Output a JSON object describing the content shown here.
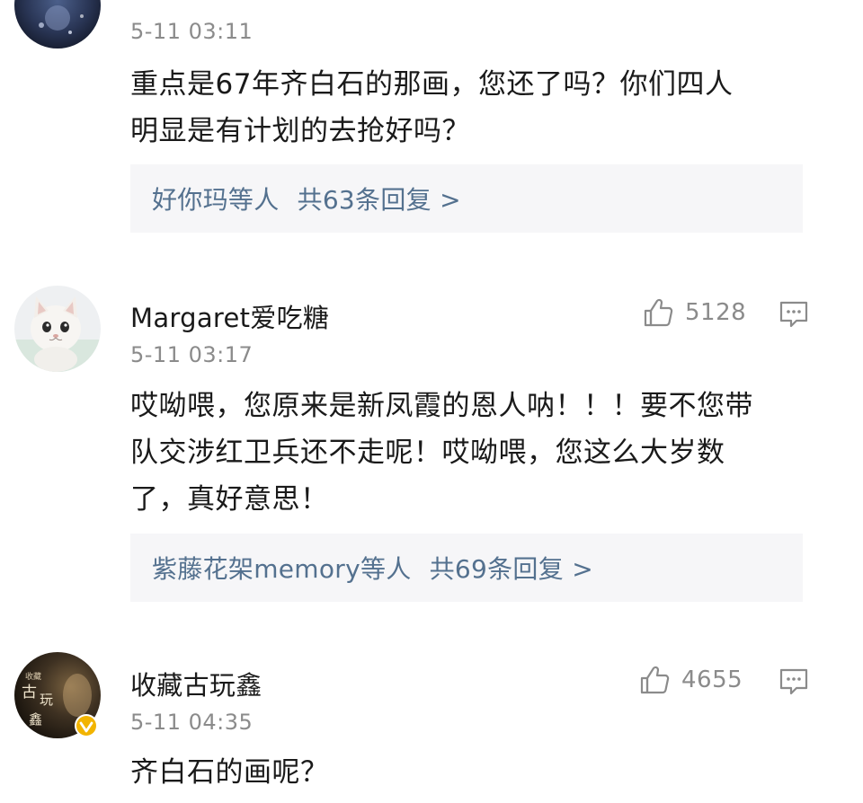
{
  "comments": [
    {
      "timestamp": "5-11 03:11",
      "text_lines": [
        "重点是67年齐白石的那画，您还了吗？你们四人",
        "明显是有计划的去抢好吗？"
      ],
      "replies": {
        "names": "好你玛等人",
        "count": "共63条回复 >"
      }
    },
    {
      "username": "Margaret爱吃糖",
      "timestamp": "5-11 03:17",
      "likes": "5128",
      "text_lines": [
        "哎呦喂，您原来是新凤霞的恩人呐！！！要不您带",
        "队交涉红卫兵还不走呢！哎呦喂，您这么大岁数",
        "了，真好意思！"
      ],
      "replies": {
        "names": "紫藤花架memory等人",
        "count": "共69条回复 >"
      }
    },
    {
      "username": "收藏古玩鑫",
      "timestamp": "5-11 04:35",
      "likes": "4655",
      "avatar_text": [
        "收藏",
        "古",
        "玩",
        "鑫"
      ],
      "text_lines": [
        "齐白石的画呢？"
      ]
    }
  ],
  "colors": {
    "link": "#54718f",
    "muted": "#8b8b8b",
    "reply_bg": "#f6f6f8",
    "verified_badge": "#f2b400"
  },
  "icons": [
    "thumbs-up-icon",
    "comment-reply-icon",
    "verified-badge-icon"
  ]
}
